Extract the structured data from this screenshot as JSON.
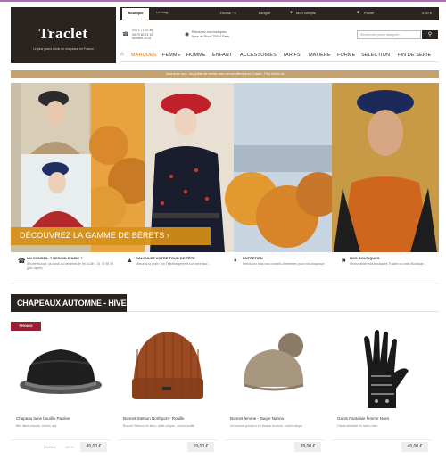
{
  "brand": {
    "name": "Traclet",
    "tagline": "Le plus grand choix de chapeaux en France"
  },
  "topbar": {
    "tab_shop": "Boutique",
    "tab_blog": "Le mag",
    "currency": "Devise : $",
    "language": "Langue",
    "account": "Mon compte",
    "cart": "Panier",
    "cart_total": "0,00 €"
  },
  "info": {
    "phone_1": "01 71 71 22 46",
    "phone_2": "06 70 60 74 10",
    "phone_3": "Nombre 2015",
    "store_1": "Retrouvez nos boutiques",
    "store_2": "5 rue de Rivoli 75004 Paris",
    "search_placeholder": "Rechercher parmi catégorie...",
    "search_icon": "search-icon"
  },
  "nav": {
    "items": [
      "MARQUES",
      "FEMME",
      "HOMME",
      "ENFANT",
      "ACCESSOIRES",
      "TARIFS",
      "MATIÈRE",
      "FORME",
      "SÉLECTION",
      "FIN DE SÉRIE"
    ]
  },
  "promo_strip": "Vous avez reçu : les points de remise vous seront offerts avec Traclet - Plus d'infos ici",
  "hero": {
    "cta": "DÉCOUVREZ LA GAMME DE BÉRETS ›"
  },
  "services": [
    {
      "title": "UN CONSEIL ? BESOIN D'AIDE ?",
      "desc": "À votre écoute, du lundi au vendredi de 9h à 18h - 01 78 98 34 (prix appel)"
    },
    {
      "title": "CALCULEZ VOTRE TOUR DE TÊTE",
      "desc": "Mesurez la grain - un Téléchargement sur votre tour..."
    },
    {
      "title": "ENTRETIEN",
      "desc": "Retrouvez tous nos conseils d'entretien pour vos chapeaux"
    },
    {
      "title": "NOS BOUTIQUES",
      "desc": "Venez visiter nos boutiques Traclet ou votre Boutique..."
    }
  ],
  "section": {
    "title": "CHAPEAUX AUTOMNE - HIVER"
  },
  "products": [
    {
      "badge": "PROMO",
      "name": "Chapeau laine bouillie Pauline",
      "desc": "Bibi laine chaude, coloris noir",
      "old_price": "69,00 €",
      "discount": "-35 %",
      "price": "45,00 €"
    },
    {
      "name": "Bonnet Stetson Northport - Rouille",
      "desc": "Bonnet Stetson en laine, taille unique, coloris rouille",
      "price": "59,00 €"
    },
    {
      "name": "Bonnet femme - Taupe Nanna",
      "desc": "Un bonnet pompon en fausse fourrure, coloris taupe",
      "price": "39,00 €"
    },
    {
      "name": "Gants Fantaisie femme Noirs",
      "desc": "Gants fantaisie en laine noire",
      "price": "45,00 €"
    }
  ],
  "colors": {
    "dark": "#2a2420",
    "accent_orange": "#d0761a",
    "gold": "#c1a270",
    "promo_red": "#9b1c33"
  }
}
